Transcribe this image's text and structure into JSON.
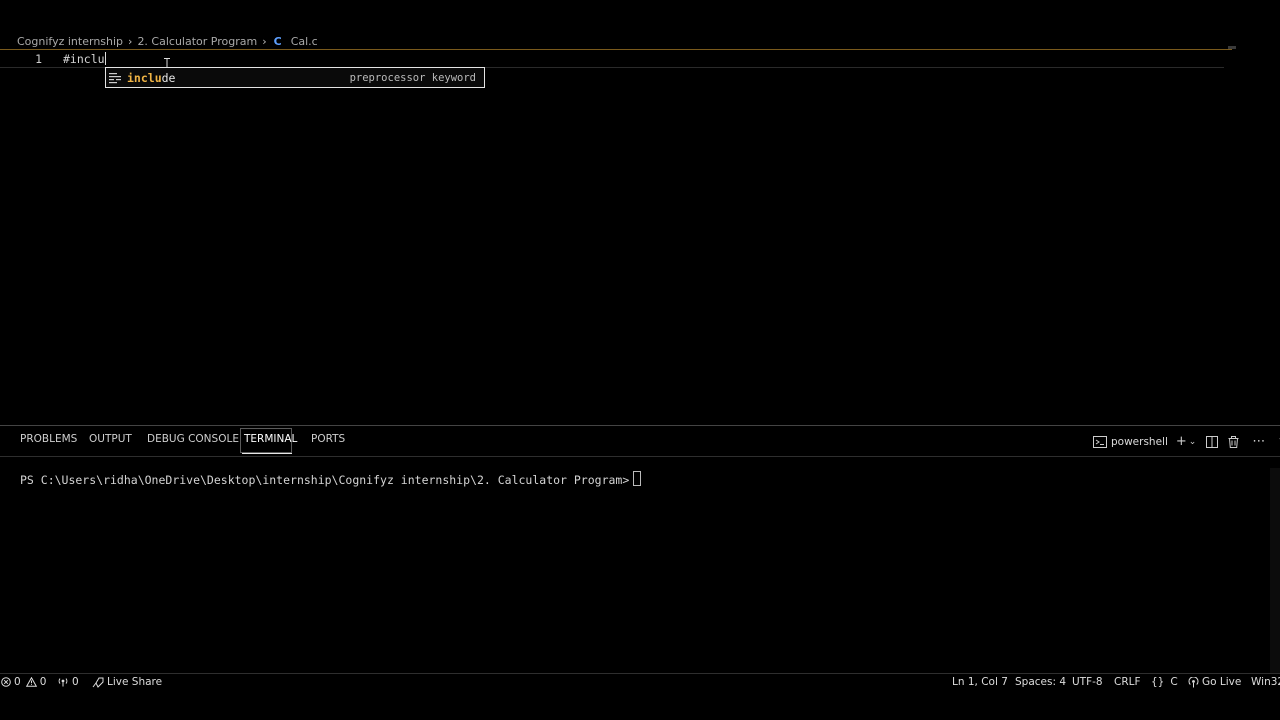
{
  "breadcrumb": {
    "items": [
      "Cognifyz internship",
      "2. Calculator Program",
      "Cal.c"
    ],
    "file_icon_glyph": "C",
    "file_icon_color": "#5ea0ff"
  },
  "editor": {
    "line_number": "1",
    "code": "#inclu",
    "suggestion": {
      "label_match": "inclu",
      "label_rest": "de",
      "detail": "preprocessor keyword",
      "icon": "snippet-icon"
    }
  },
  "panel": {
    "tabs": [
      "PROBLEMS",
      "OUTPUT",
      "DEBUG CONSOLE",
      "TERMINAL",
      "PORTS"
    ],
    "active_tab": "TERMINAL",
    "shell": "powershell",
    "actions": [
      "plus-icon",
      "chevron-down-icon",
      "split-icon",
      "trash-icon",
      "ellipsis-icon",
      "chevron-up-icon"
    ]
  },
  "terminal": {
    "prompt": "PS C:\\Users\\ridha\\OneDrive\\Desktop\\internship\\Cognifyz internship\\2. Calculator Program>"
  },
  "status_bar": {
    "errors": "0",
    "warnings": "0",
    "ports": "0",
    "live_share": "Live Share",
    "position": "Ln 1, Col 7",
    "spaces": "Spaces: 4",
    "encoding": "UTF-8",
    "eol": "CRLF",
    "language": "C",
    "go_live": "Go Live",
    "platform": "Win32"
  },
  "colors": {
    "accent_highlight": "#f0b445",
    "background": "#000000"
  }
}
